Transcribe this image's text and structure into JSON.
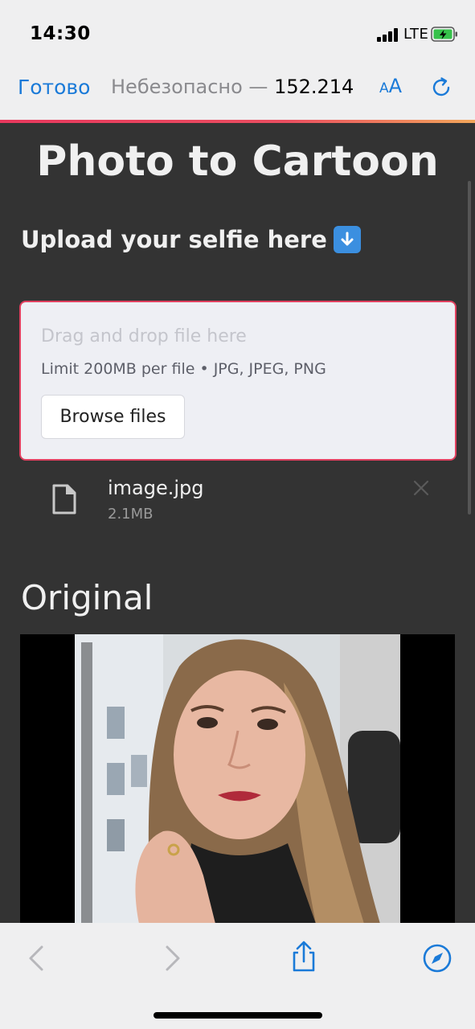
{
  "status": {
    "time": "14:30",
    "network": "LTE"
  },
  "browser": {
    "done_label": "Готово",
    "insecure_label": "Небезопасно — ",
    "host": "152.214",
    "text_size_label": "AA"
  },
  "app": {
    "title": "Photo to Cartoon",
    "subtitle": "Upload your selfie here",
    "dropzone": {
      "main_text": "Drag and drop file here",
      "limit_text": "Limit 200MB per file • JPG, JPEG, PNG",
      "browse_label": "Browse files"
    },
    "uploaded_file": {
      "name": "image.jpg",
      "size": "2.1MB"
    },
    "original_heading": "Original"
  },
  "colors": {
    "page_bg": "#333333",
    "accent_blue": "#1a7ad8",
    "dropzone_border": "#e0405f",
    "dropzone_bg": "#eeeff4"
  },
  "icons": [
    "signal-icon",
    "battery-charging-icon",
    "reload-icon",
    "down-arrow-emoji",
    "file-icon",
    "close-icon",
    "back-icon",
    "forward-icon",
    "share-icon",
    "compass-icon"
  ]
}
